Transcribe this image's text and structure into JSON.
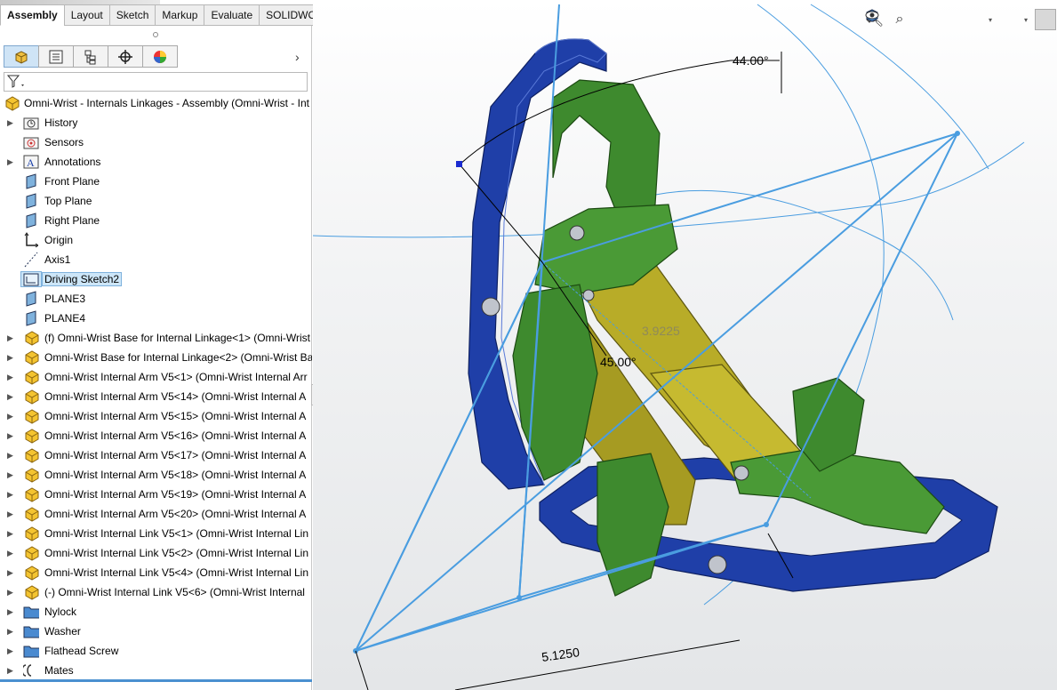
{
  "command_tabs": [
    "Assembly",
    "Layout",
    "Sketch",
    "Markup",
    "Evaluate",
    "SOLIDWORKS Add-Ins"
  ],
  "active_tab": "Assembly",
  "feature_manager": {
    "tab_icons": [
      "feature-manager-icon",
      "property-manager-icon",
      "configuration-manager-icon",
      "dimxpert-icon",
      "display-manager-icon"
    ],
    "root": "Omni-Wrist - Internals Linkages - Assembly (Omni-Wrist - Int",
    "items": [
      {
        "label": "History",
        "icon": "history-folder-icon",
        "expandable": true
      },
      {
        "label": "Sensors",
        "icon": "sensors-icon",
        "expandable": false
      },
      {
        "label": "Annotations",
        "icon": "annotations-icon",
        "expandable": true
      },
      {
        "label": "Front Plane",
        "icon": "plane-icon",
        "expandable": false
      },
      {
        "label": "Top Plane",
        "icon": "plane-icon",
        "expandable": false
      },
      {
        "label": "Right Plane",
        "icon": "plane-icon",
        "expandable": false
      },
      {
        "label": "Origin",
        "icon": "origin-icon",
        "expandable": false
      },
      {
        "label": "Axis1",
        "icon": "axis-icon",
        "expandable": false
      },
      {
        "label": "Driving Sketch2",
        "icon": "sketch-icon",
        "expandable": false,
        "selected": true
      },
      {
        "label": "PLANE3",
        "icon": "plane-icon",
        "expandable": false
      },
      {
        "label": "PLANE4",
        "icon": "plane-icon",
        "expandable": false
      },
      {
        "label": "(f) Omni-Wrist Base for Internal Linkage<1> (Omni-Wrist",
        "icon": "part-icon",
        "expandable": true
      },
      {
        "label": "Omni-Wrist Base for Internal Linkage<2> (Omni-Wrist Ba",
        "icon": "part-icon",
        "expandable": true
      },
      {
        "label": "Omni-Wrist Internal Arm V5<1> (Omni-Wrist Internal Arr",
        "icon": "part-icon",
        "expandable": true
      },
      {
        "label": "Omni-Wrist Internal Arm V5<14> (Omni-Wrist Internal A",
        "icon": "part-icon",
        "expandable": true
      },
      {
        "label": "Omni-Wrist Internal Arm V5<15> (Omni-Wrist Internal A",
        "icon": "part-icon",
        "expandable": true
      },
      {
        "label": "Omni-Wrist Internal Arm V5<16> (Omni-Wrist Internal A",
        "icon": "part-icon",
        "expandable": true
      },
      {
        "label": "Omni-Wrist Internal Arm V5<17> (Omni-Wrist Internal A",
        "icon": "part-icon",
        "expandable": true
      },
      {
        "label": "Omni-Wrist Internal Arm V5<18> (Omni-Wrist Internal A",
        "icon": "part-icon",
        "expandable": true
      },
      {
        "label": "Omni-Wrist Internal Arm V5<19> (Omni-Wrist Internal A",
        "icon": "part-icon",
        "expandable": true
      },
      {
        "label": "Omni-Wrist Internal Arm V5<20> (Omni-Wrist Internal A",
        "icon": "part-icon",
        "expandable": true
      },
      {
        "label": "Omni-Wrist Internal Link V5<1> (Omni-Wrist Internal Lin",
        "icon": "part-icon",
        "expandable": true
      },
      {
        "label": "Omni-Wrist Internal Link V5<2> (Omni-Wrist Internal Lin",
        "icon": "part-icon",
        "expandable": true
      },
      {
        "label": "Omni-Wrist Internal Link V5<4> (Omni-Wrist Internal Lin",
        "icon": "part-icon",
        "expandable": true
      },
      {
        "label": "(-) Omni-Wrist Internal Link V5<6> (Omni-Wrist Internal",
        "icon": "part-icon",
        "expandable": true
      },
      {
        "label": "Nylock",
        "icon": "folder-icon",
        "expandable": true
      },
      {
        "label": "Washer",
        "icon": "folder-icon",
        "expandable": true
      },
      {
        "label": "Flathead Screw",
        "icon": "folder-icon",
        "expandable": true
      },
      {
        "label": "Mates",
        "icon": "mates-icon",
        "expandable": true
      }
    ]
  },
  "viewport": {
    "dimensions": {
      "angle_top": "44.00°",
      "angle_mid": "45.00°",
      "length_mid": "3.9225",
      "length_bottom": "5.1250"
    },
    "heads_up_icons": [
      "zoom-to-fit-icon",
      "zoom-to-area-icon",
      "previous-view-icon",
      "section-view-icon",
      "view-orientation-icon",
      "display-style-icon",
      "hide-show-items-icon"
    ],
    "colors": {
      "frame_blue": "#1f3fa8",
      "arm_green": "#3e8a2e",
      "link_yellow": "#b8ac28",
      "sketch_blue": "#4a9de0"
    }
  }
}
